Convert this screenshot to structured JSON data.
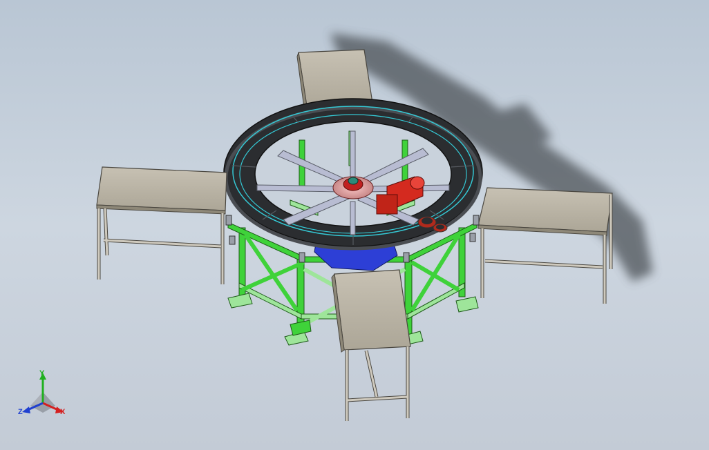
{
  "triad": {
    "y_label": "Y",
    "x_label": "X",
    "z_label": "Z"
  },
  "colors": {
    "background_top": "#b9c6d4",
    "background_bottom": "#c3cbd6",
    "frame_green": "#3fd23a",
    "frame_green_light": "#9ee59a",
    "table_top": "#bcb6a7",
    "table_legs": "#cfcabe",
    "ring_dark": "#2b2d30",
    "ring_cyan": "#34c8d4",
    "motor_red": "#d42a1f",
    "gearbox_blue": "#2d3fd6",
    "hub_pink": "#e0a0a0",
    "axis_x": "#d42020",
    "axis_y": "#20b020",
    "axis_z": "#2040d0"
  }
}
